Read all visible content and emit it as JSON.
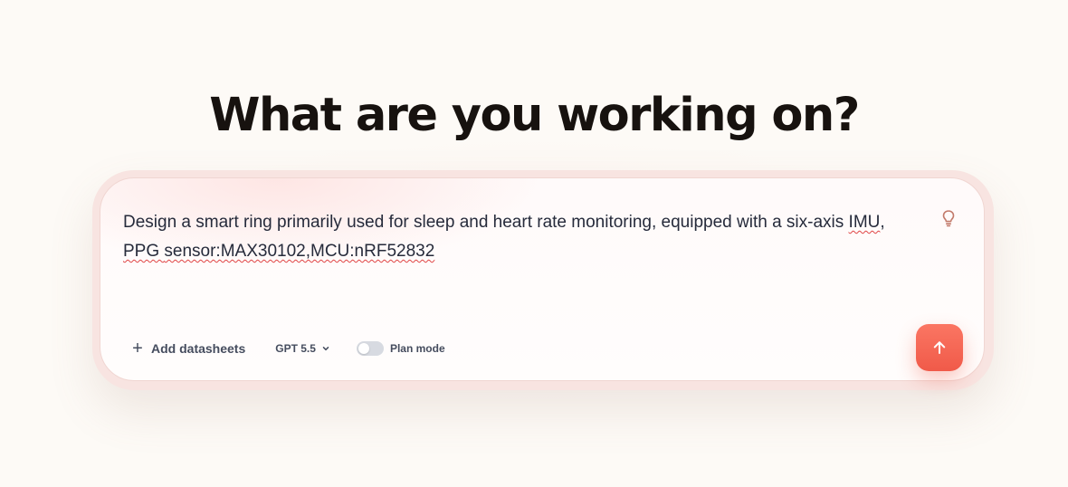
{
  "headline": "What are you working on?",
  "prompt": {
    "line1_plain": "Design a smart ring primarily used for sleep and heart rate monitoring, equipped with a six-axis ",
    "line1_flagged": "IMU",
    "line1_end": ",",
    "line2_plain": "PPG ",
    "line2_flagged": "sensor:MAX30102,MCU:nRF52832"
  },
  "toolbar": {
    "add_datasheets_label": "Add datasheets",
    "model_label": "GPT 5.5",
    "plan_mode_label": "Plan mode",
    "plan_mode_enabled": false
  },
  "icons": {
    "hint": "lightbulb-icon",
    "add": "plus-icon",
    "model_dropdown": "chevron-down-icon",
    "send": "arrow-up-icon"
  },
  "colors": {
    "accent": "#f2604e",
    "headline": "#17120f",
    "text": "#262b3b",
    "toolbar_text": "#454c5e",
    "bulb": "#c27a6a",
    "spellcheck": "#e04545"
  }
}
